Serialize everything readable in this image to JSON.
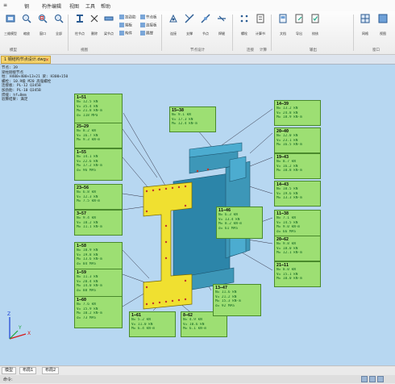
{
  "menu": [
    "≡",
    "钢",
    "构件编辑",
    "视图",
    "工具",
    "帮助"
  ],
  "ribbon": {
    "buttons": [
      {
        "icon": "model-icon",
        "label": "三维模型"
      },
      {
        "icon": "zoom-icon",
        "label": "缩放"
      },
      {
        "icon": "zoom-window-icon",
        "label": "窗口"
      },
      {
        "icon": "zoom-all-icon",
        "label": "全部"
      },
      {
        "icon": "column-icon",
        "label": "柱节点"
      },
      {
        "icon": "delete-icon",
        "label": "删除"
      },
      {
        "icon": "beam-icon",
        "label": "梁节点"
      },
      {
        "icon": "connect-icon",
        "label": "连接"
      },
      {
        "icon": "brace-icon",
        "label": "支撑"
      },
      {
        "icon": "joint-icon",
        "label": "节点"
      },
      {
        "icon": "weld-icon",
        "label": "焊缝"
      },
      {
        "icon": "bolt-icon",
        "label": "螺栓"
      },
      {
        "icon": "calc-icon",
        "label": "计算书"
      },
      {
        "icon": "doc-icon",
        "label": "文档"
      },
      {
        "icon": "export-icon",
        "label": "导出"
      },
      {
        "icon": "check-icon",
        "label": "校核"
      },
      {
        "icon": "grid-icon",
        "label": "网格"
      },
      {
        "icon": "view-icon",
        "label": "视图"
      }
    ],
    "small_items": [
      "加劲肋",
      "端板",
      "构件",
      "节点板",
      "连接板",
      "隅撑"
    ],
    "groups": [
      "模型",
      "视图",
      "节点设计",
      "连接",
      "计算",
      "输出",
      "窗口"
    ]
  },
  "doc_tab": {
    "label": "1 钢结构节点设计.dwg",
    "close": "×"
  },
  "info_lines": [
    "节点: 39",
    "梁柱刚接节点",
    "柱: H400×400×13×21  梁: H300×150",
    "螺栓: 10.9级 M20 高强螺栓",
    "连接板: PL-12  Q345B",
    "加劲肋: PL-10  Q345B",
    "焊缝: hf=8mm",
    "验算结果: 满足"
  ],
  "callouts": [
    {
      "id": "c1",
      "head": "1—51",
      "lines": [
        "N= 12.5 kN",
        "V= 35.4 kN",
        "M= 21.8 kN·m",
        "σ= 118 MPa"
      ]
    },
    {
      "id": "c2",
      "head": "25—29",
      "lines": [
        "N= 8.2 kN",
        "V= 16.7 kN",
        "M= 9.3 kN·m"
      ]
    },
    {
      "id": "c3",
      "head": "1—55",
      "lines": [
        "N= 14.1 kN",
        "V= 22.6 kN",
        "M= 17.2 kN·m",
        "σ= 96 MPa"
      ]
    },
    {
      "id": "c4",
      "head": "23—56",
      "lines": [
        "N= 6.8 kN",
        "V= 12.3 kN",
        "M= 7.5 kN·m"
      ]
    },
    {
      "id": "c5",
      "head": "3—57",
      "lines": [
        "N= 9.4 kN",
        "V= 18.2 kN",
        "M= 11.1 kN·m"
      ]
    },
    {
      "id": "c6",
      "head": "1—58",
      "lines": [
        "N= 10.9 kN",
        "V= 19.8 kN",
        "M= 13.6 kN·m",
        "σ= 84 MPa"
      ]
    },
    {
      "id": "c7",
      "head": "1—59",
      "lines": [
        "N= 11.3 kN",
        "V= 20.4 kN",
        "M= 14.0 kN·m",
        "σ= 88 MPa"
      ]
    },
    {
      "id": "c8",
      "head": "1—60",
      "lines": [
        "N= 7.6 kN",
        "V= 15.9 kN",
        "M= 10.2 kN·m",
        "σ= 73 MPa"
      ]
    },
    {
      "id": "c9",
      "head": "1—61",
      "lines": [
        "N= 5.2 kN",
        "V= 11.0 kN",
        "M= 6.4 kN·m"
      ]
    },
    {
      "id": "c10",
      "head": "8—62",
      "lines": [
        "N= 4.9 kN",
        "V= 10.6 kN",
        "M= 6.1 kN·m"
      ]
    },
    {
      "id": "c11",
      "head": "15—38",
      "lines": [
        "N= 9.1 kN",
        "V= 17.3 kN",
        "M= 12.4 kN·m"
      ]
    },
    {
      "id": "c12",
      "head": "14—39",
      "lines": [
        "N= 13.2 kN",
        "V= 24.8 kN",
        "M= 18.9 kN·m"
      ]
    },
    {
      "id": "c13",
      "head": "20—40",
      "lines": [
        "N= 12.0 kN",
        "V= 23.1 kN",
        "M= 16.5 kN·m"
      ]
    },
    {
      "id": "c14",
      "head": "19—43",
      "lines": [
        "N= 8.7 kN",
        "V= 16.2 kN",
        "M= 10.8 kN·m"
      ]
    },
    {
      "id": "c15",
      "head": "14—43",
      "lines": [
        "N= 10.5 kN",
        "V= 19.6 kN",
        "M= 13.3 kN·m"
      ]
    },
    {
      "id": "c16",
      "head": "11—46",
      "lines": [
        "N= 6.3 kN",
        "V= 13.4 kN",
        "M= 8.2 kN·m",
        "σ= 61 MPa"
      ]
    },
    {
      "id": "c17",
      "head": "11—38",
      "lines": [
        "N= 7.1 kN",
        "V= 14.5 kN",
        "M= 9.0 kN·m",
        "σ= 66 MPa"
      ]
    },
    {
      "id": "c18",
      "head": "20—62",
      "lines": [
        "N= 9.8 kN",
        "V= 18.0 kN",
        "M= 12.1 kN·m"
      ]
    },
    {
      "id": "c19",
      "head": "21—11",
      "lines": [
        "N= 8.0 kN",
        "V= 15.1 kN",
        "M= 10.0 kN·m"
      ]
    },
    {
      "id": "c20",
      "head": "13—47",
      "lines": [
        "N= 11.6 kN",
        "V= 21.2 kN",
        "M= 15.3 kN·m",
        "σ= 92 MPa"
      ]
    }
  ],
  "axes": {
    "x": "X",
    "y": "Y",
    "z": "Z"
  },
  "status": {
    "tabs": [
      "模型",
      "布局1",
      "布局2"
    ],
    "text": "命令:"
  },
  "colors": {
    "viewport": "#b7d7f1",
    "callout": "#9ddf73",
    "steel_blue": "#3d97b8",
    "plate_yellow": "#f0e030",
    "tab_active": "#f5d36b"
  }
}
